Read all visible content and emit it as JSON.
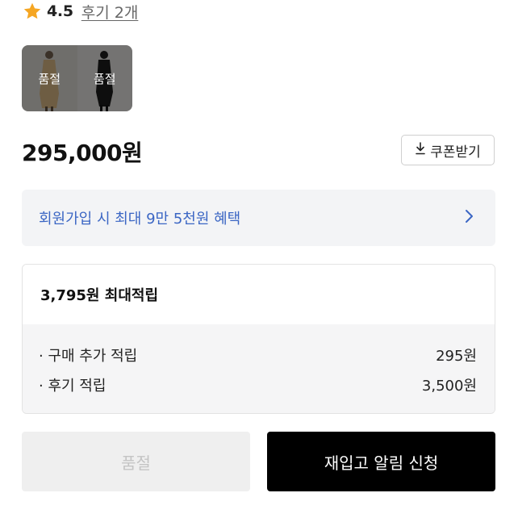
{
  "rating": {
    "value": "4.5",
    "review_link": "후기 2개",
    "star_color": "#F5A623"
  },
  "thumbnails": [
    {
      "overlay_label": "품절"
    },
    {
      "overlay_label": "품절"
    }
  ],
  "price": "295,000원",
  "coupon": {
    "label": "쿠폰받기",
    "icon": "download-icon"
  },
  "benefit_banner": {
    "text": "회원가입 시 최대 9만 5천원 혜택",
    "icon": "chevron-right-icon",
    "text_color": "#3B66C4"
  },
  "points": {
    "title": "3,795원 최대적립",
    "rows": [
      {
        "label": "· 구매 추가 적립",
        "value": "295원"
      },
      {
        "label": "· 후기 적립",
        "value": "3,500원"
      }
    ]
  },
  "actions": {
    "soldout_label": "품절",
    "restock_label": "재입고 알림 신청"
  }
}
